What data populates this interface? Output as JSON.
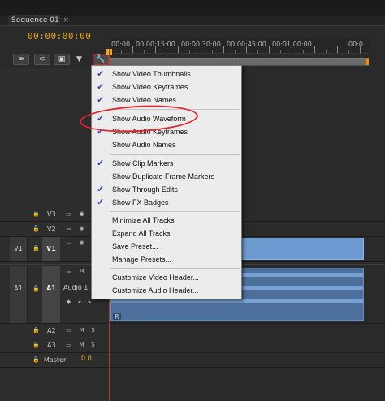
{
  "panel": {
    "tab_label": "Sequence 01",
    "tab_close": "×",
    "timecode": "00:00:00:00"
  },
  "ruler": {
    "labels": [
      "00:00",
      "00:00:15:00",
      "00:00:30:00",
      "00:00:45:00",
      "00:01:00:00",
      "00:0"
    ]
  },
  "toolbar": {
    "snap_icon": "snap-icon",
    "linked_icon": "linked-selection-icon",
    "add_marker_icon": "add-marker-icon",
    "marker_icon": "marker-icon",
    "settings_icon": "wrench-icon"
  },
  "tracks": {
    "video": [
      {
        "name": "V3",
        "source_patch": ""
      },
      {
        "name": "V2",
        "source_patch": ""
      },
      {
        "name": "V1",
        "source_patch": "V1"
      }
    ],
    "audio": [
      {
        "name": "A1",
        "source_patch": "A1",
        "label": "Audio 1",
        "mute": "M",
        "solo": "S"
      },
      {
        "name": "A2",
        "source_patch": "",
        "mute": "M",
        "solo": "S"
      },
      {
        "name": "A3",
        "source_patch": "",
        "mute": "M",
        "solo": "S"
      }
    ],
    "master": {
      "label": "Master",
      "value": "0.0"
    },
    "clip_marker": "R"
  },
  "menu": {
    "items": [
      {
        "label": "Show Video Thumbnails",
        "checked": true
      },
      {
        "label": "Show Video Keyframes",
        "checked": true
      },
      {
        "label": "Show Video Names",
        "checked": true
      },
      {
        "label": "Show Audio Waveform",
        "checked": true
      },
      {
        "label": "Show Audio Keyframes",
        "checked": true
      },
      {
        "label": "Show Audio Names",
        "checked": false
      },
      {
        "label": "Show Clip Markers",
        "checked": true
      },
      {
        "label": "Show Duplicate Frame Markers",
        "checked": false
      },
      {
        "label": "Show Through Edits",
        "checked": true
      },
      {
        "label": "Show FX Badges",
        "checked": true
      },
      {
        "label": "Minimize All Tracks",
        "checked": false
      },
      {
        "label": "Expand All Tracks",
        "checked": false
      },
      {
        "label": "Save Preset...",
        "checked": false
      },
      {
        "label": "Manage Presets...",
        "checked": false
      },
      {
        "label": "Customize Video Header...",
        "checked": false
      },
      {
        "label": "Customize Audio Header...",
        "checked": false
      }
    ],
    "check_glyph": "✓"
  },
  "colors": {
    "timecode": "#e9a61e",
    "playhead": "#d12d2d",
    "video_clip": "#6d9bd1",
    "audio_clip": "#4c6f9b",
    "annotation": "#e0262e"
  }
}
